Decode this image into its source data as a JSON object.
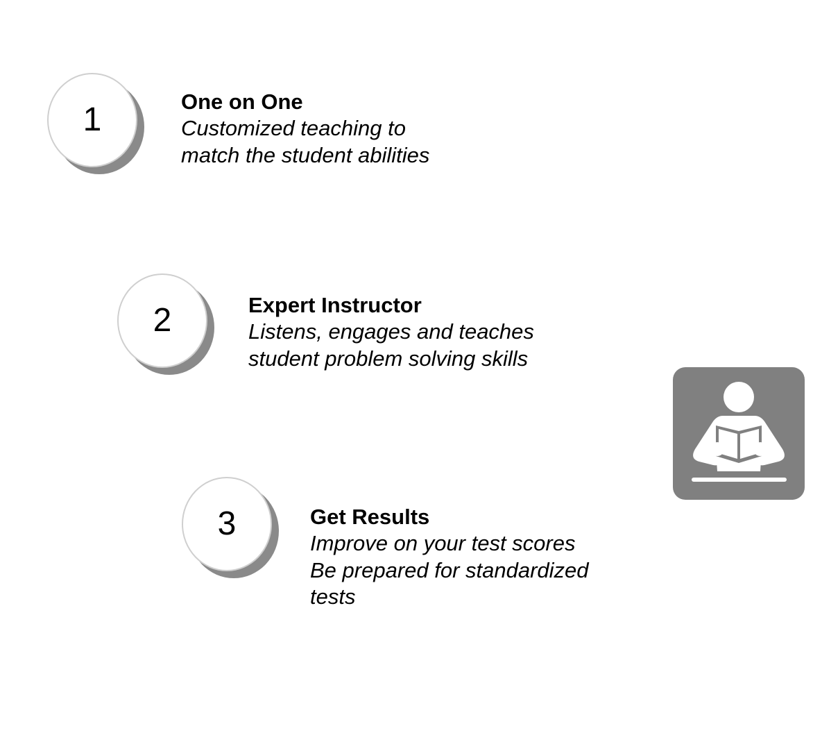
{
  "steps": [
    {
      "number": "1",
      "title": "One on One",
      "lines": [
        "Customized teaching to",
        "match the student abilities"
      ]
    },
    {
      "number": "2",
      "title": "Expert Instructor",
      "lines": [
        "Listens, engages and teaches",
        "student problem solving skills"
      ]
    },
    {
      "number": "3",
      "title": "Get Results",
      "lines": [
        "Improve on your test scores",
        "Be prepared for standardized",
        "tests"
      ]
    }
  ],
  "icon": {
    "name": "person-reading-book-icon",
    "tile_color": "#808080",
    "figure_color": "#ffffff"
  },
  "colors": {
    "circle_shadow": "#8a8a8a",
    "circle_border": "#cfcfcf",
    "text": "#000000"
  }
}
